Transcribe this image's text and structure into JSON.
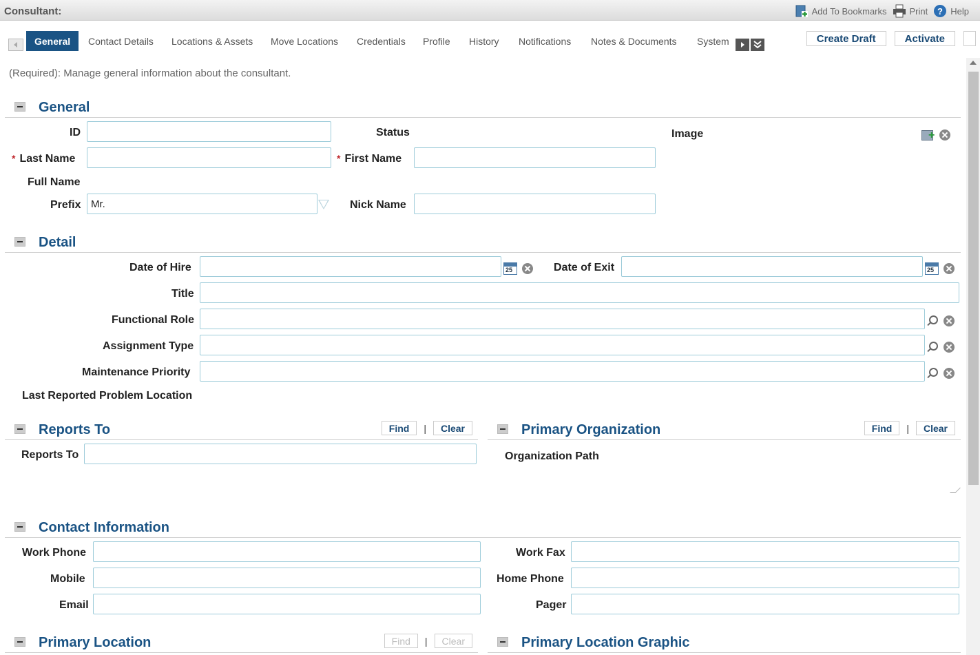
{
  "header": {
    "title": "Consultant:",
    "links": {
      "bookmarks": "Add To Bookmarks",
      "print": "Print",
      "help": "Help"
    }
  },
  "tabs": [
    "General",
    "Contact Details",
    "Locations & Assets",
    "Move Locations",
    "Credentials",
    "Profile",
    "History",
    "Notifications",
    "Notes & Documents",
    "System"
  ],
  "actions": {
    "create_draft": "Create Draft",
    "activate": "Activate"
  },
  "description": "(Required): Manage general information about the consultant.",
  "general": {
    "title": "General",
    "id_label": "ID",
    "id_value": "",
    "status_label": "Status",
    "image_label": "Image",
    "last_name_label": "Last Name",
    "last_name_value": "",
    "first_name_label": "First Name",
    "first_name_value": "",
    "full_name_label": "Full Name",
    "prefix_label": "Prefix",
    "prefix_value": "Mr.",
    "nick_name_label": "Nick Name",
    "nick_name_value": "",
    "required_mark": "*"
  },
  "detail": {
    "title": "Detail",
    "date_hire_label": "Date of Hire",
    "date_exit_label": "Date of Exit",
    "title_label": "Title",
    "functional_role_label": "Functional Role",
    "assignment_type_label": "Assignment Type",
    "maintenance_priority_label": "Maintenance Priority",
    "last_problem_location_label": "Last Reported Problem Location",
    "calendar_day": "25"
  },
  "reports_to": {
    "title": "Reports To",
    "find": "Find",
    "clear": "Clear",
    "field_label": "Reports To",
    "separator": "|"
  },
  "primary_org": {
    "title": "Primary Organization",
    "find": "Find",
    "clear": "Clear",
    "path_label": "Organization Path",
    "separator": "|"
  },
  "contact": {
    "title": "Contact Information",
    "work_phone": "Work Phone",
    "mobile": "Mobile",
    "email": "Email",
    "work_fax": "Work Fax",
    "home_phone": "Home Phone",
    "pager": "Pager"
  },
  "primary_location": {
    "title": "Primary Location",
    "find": "Find",
    "clear": "Clear",
    "separator": "|"
  },
  "primary_location_graphic": {
    "title": "Primary Location Graphic"
  },
  "colors": {
    "accent": "#1a5384",
    "required": "#c0282d",
    "input_border": "#9ccbd9"
  }
}
